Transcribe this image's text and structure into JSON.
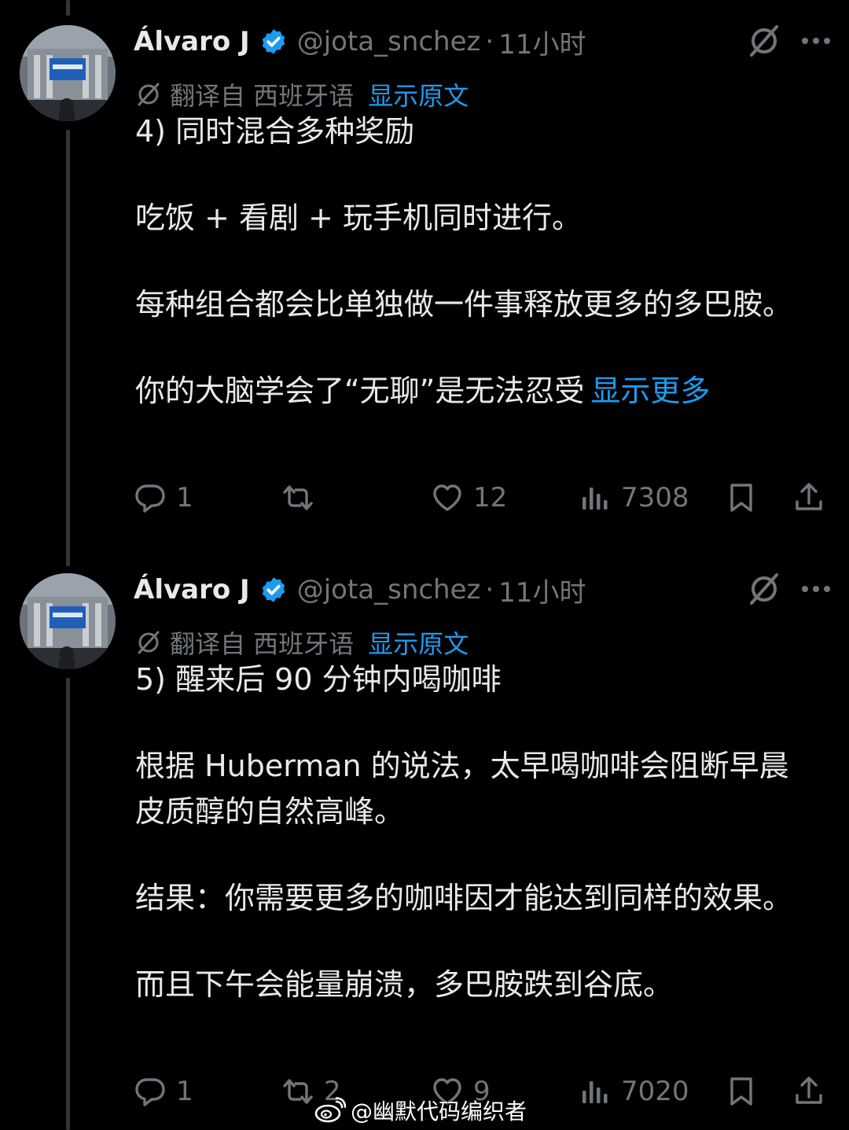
{
  "tweets": [
    {
      "author_name": "Álvaro J",
      "handle": "@jota_snchez",
      "separator": "·",
      "time": "11小时",
      "translation_label": "翻译自 西班牙语",
      "show_original": "显示原文",
      "paragraphs": [
        "4) 同时混合多种奖励",
        "吃饭 + 看剧 + 玩手机同时进行。",
        "每种组合都会比单独做一件事释放更多的多巴胺。",
        "你的大脑学会了“无聊”是无法忍受"
      ],
      "show_more": "显示更多",
      "replies": "1",
      "reposts": "",
      "likes": "12",
      "views": "7308"
    },
    {
      "author_name": "Álvaro J",
      "handle": "@jota_snchez",
      "separator": "·",
      "time": "11小时",
      "translation_label": "翻译自 西班牙语",
      "show_original": "显示原文",
      "paragraphs": [
        "5) 醒来后 90 分钟内喝咖啡",
        "根据 Huberman 的说法，太早喝咖啡会阻断早晨皮质醇的自然高峰。",
        "结果：你需要更多的咖啡因才能达到同样的效果。",
        "而且下午会能量崩溃，多巴胺跌到谷底。"
      ],
      "replies": "1",
      "reposts": "2",
      "likes": "9",
      "views": "7020"
    }
  ],
  "watermark": "@幽默代码编织者",
  "colors": {
    "background": "#000000",
    "text": "#e7e9ea",
    "muted": "#71767b",
    "accent": "#1d9bf0",
    "thread_line": "#333639"
  },
  "icons": [
    "verified-badge-icon",
    "grok-icon",
    "more-icon",
    "translate-icon",
    "reply-icon",
    "repost-icon",
    "like-icon",
    "views-icon",
    "bookmark-icon",
    "share-icon",
    "weibo-icon"
  ]
}
